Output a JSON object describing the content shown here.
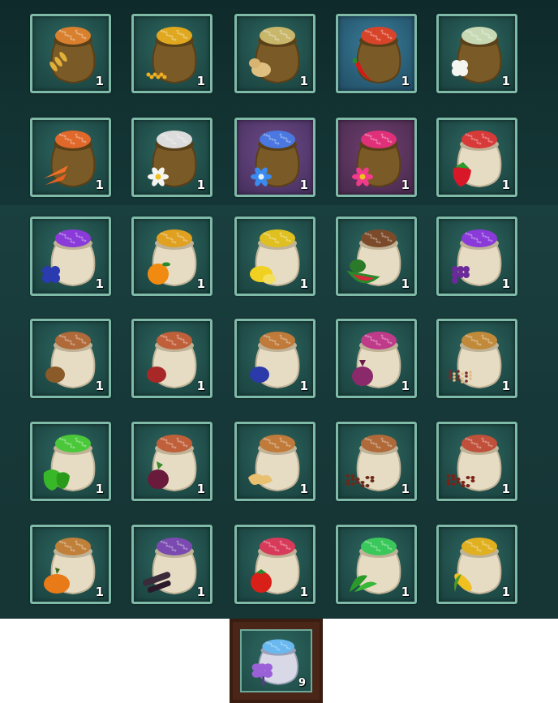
{
  "inventory": {
    "slots": [
      {
        "name": "seed-bag-wheat",
        "bag": "brown",
        "seed": "#d8802e",
        "tint": "green",
        "produce": "wheat",
        "count": "1"
      },
      {
        "name": "seed-bag-corn",
        "bag": "brown",
        "seed": "#e0a81e",
        "tint": "green",
        "produce": "corn-kernels",
        "count": "1"
      },
      {
        "name": "seed-bag-potato",
        "bag": "brown",
        "seed": "#c8b66a",
        "tint": "green",
        "produce": "potato",
        "count": "1"
      },
      {
        "name": "seed-bag-chili",
        "bag": "brown",
        "seed": "#d8442a",
        "tint": "blue",
        "produce": "chili",
        "count": "1"
      },
      {
        "name": "seed-bag-cotton",
        "bag": "brown",
        "seed": "#c6d8b4",
        "tint": "green",
        "produce": "cotton",
        "count": "1"
      },
      {
        "name": "seed-bag-carrot",
        "bag": "brown",
        "seed": "#e0682a",
        "tint": "green",
        "produce": "carrot",
        "count": "1"
      },
      {
        "name": "seed-bag-white-lotus",
        "bag": "brown",
        "seed": "#dcdcdc",
        "tint": "green",
        "produce": "white-flower",
        "count": "1"
      },
      {
        "name": "seed-bag-blue-lotus",
        "bag": "brown",
        "seed": "#4a78e0",
        "tint": "purple",
        "produce": "blue-flower",
        "count": "1"
      },
      {
        "name": "seed-bag-pink-lotus",
        "bag": "brown",
        "seed": "#e0307a",
        "tint": "pink",
        "produce": "pink-flower",
        "count": "1"
      },
      {
        "name": "seed-bag-strawberry",
        "bag": "cream",
        "seed": "#d83a3a",
        "tint": "green",
        "produce": "strawberry",
        "count": "1"
      },
      {
        "name": "seed-bag-blueberry",
        "bag": "cream",
        "seed": "#8a3ad8",
        "tint": "green",
        "produce": "blueberry",
        "count": "1"
      },
      {
        "name": "seed-bag-orange",
        "bag": "cream",
        "seed": "#e0a020",
        "tint": "green",
        "produce": "orange",
        "count": "1"
      },
      {
        "name": "seed-bag-lemon",
        "bag": "cream",
        "seed": "#e0c020",
        "tint": "green",
        "produce": "lemon",
        "count": "1"
      },
      {
        "name": "seed-bag-watermelon",
        "bag": "cream",
        "seed": "#7a4a2a",
        "tint": "green",
        "produce": "watermelon",
        "count": "1"
      },
      {
        "name": "seed-bag-grape",
        "bag": "cream",
        "seed": "#8a3ad8",
        "tint": "green",
        "produce": "grape",
        "count": "1"
      },
      {
        "name": "seed-bag-brown-bean",
        "bag": "cream",
        "seed": "#b06a3a",
        "tint": "green",
        "produce": "brown-bean",
        "count": "1"
      },
      {
        "name": "seed-bag-red-bean",
        "bag": "cream",
        "seed": "#c0603a",
        "tint": "green",
        "produce": "red-bean",
        "count": "1"
      },
      {
        "name": "seed-bag-blue-bean",
        "bag": "cream",
        "seed": "#c07a3a",
        "tint": "green",
        "produce": "blue-bean",
        "count": "1"
      },
      {
        "name": "seed-bag-onion",
        "bag": "cream",
        "seed": "#c03a8a",
        "tint": "green",
        "produce": "onion",
        "count": "1"
      },
      {
        "name": "seed-bag-quinoa",
        "bag": "cream",
        "seed": "#c08a3a",
        "tint": "green",
        "produce": "quinoa",
        "count": "1"
      },
      {
        "name": "seed-bag-pepper",
        "bag": "cream",
        "seed": "#4ac83a",
        "tint": "green",
        "produce": "bell-pepper",
        "count": "1"
      },
      {
        "name": "seed-bag-beet",
        "bag": "cream",
        "seed": "#c0603a",
        "tint": "green",
        "produce": "beet",
        "count": "1"
      },
      {
        "name": "seed-bag-ginger",
        "bag": "cream",
        "seed": "#c07a3a",
        "tint": "green",
        "produce": "ginger",
        "count": "1"
      },
      {
        "name": "seed-bag-coffee",
        "bag": "cream",
        "seed": "#b06a3a",
        "tint": "green",
        "produce": "coffee-beans",
        "count": "1"
      },
      {
        "name": "seed-bag-red-coffee",
        "bag": "cream",
        "seed": "#c0503a",
        "tint": "green",
        "produce": "red-beans",
        "count": "1"
      },
      {
        "name": "seed-bag-pumpkin",
        "bag": "cream",
        "seed": "#c0803a",
        "tint": "green",
        "produce": "pumpkin",
        "count": "1"
      },
      {
        "name": "seed-bag-cassava",
        "bag": "cream",
        "seed": "#7a4ab0",
        "tint": "green",
        "produce": "cassava",
        "count": "1"
      },
      {
        "name": "seed-bag-tomato",
        "bag": "cream",
        "seed": "#d83a5a",
        "tint": "green",
        "produce": "tomato",
        "count": "1"
      },
      {
        "name": "seed-bag-spinach",
        "bag": "cream",
        "seed": "#3ac85a",
        "tint": "green",
        "produce": "spinach",
        "count": "1"
      },
      {
        "name": "seed-bag-yellow-corn",
        "bag": "cream",
        "seed": "#e0b020",
        "tint": "green",
        "produce": "corn-cob",
        "count": "1"
      }
    ]
  },
  "selected_item": {
    "name": "selected-seed-bag-blue-flower",
    "bag": "blue",
    "seed": "#6ab8f0",
    "produce": "blue-sprig",
    "count": "9"
  }
}
